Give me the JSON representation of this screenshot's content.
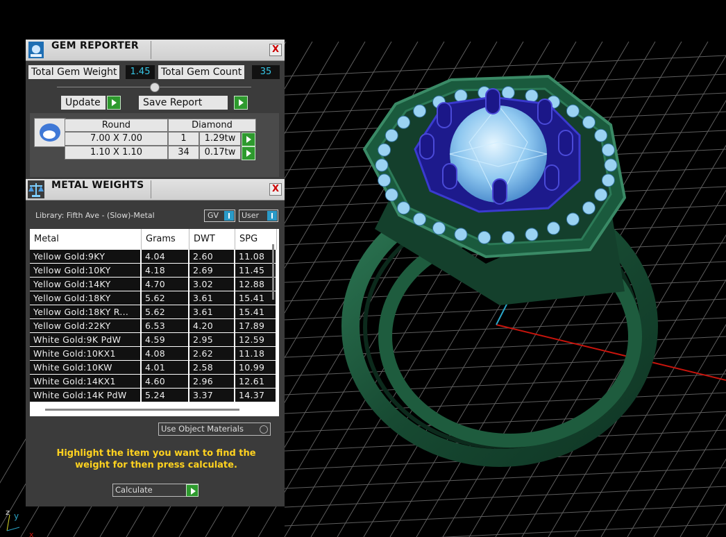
{
  "gem_reporter": {
    "title": "GEM REPORTER",
    "close_label": "X",
    "total_weight_label": "Total Gem Weight",
    "total_weight_value": "1.45",
    "total_count_label": "Total Gem Count",
    "total_count_value": "35",
    "update_label": "Update",
    "save_label": "Save Report",
    "header_shape": "Round",
    "header_type": "Diamond",
    "gems": [
      {
        "size": "7.00 X 7.00",
        "count": "1",
        "weight": "1.29tw"
      },
      {
        "size": "1.10 X 1.10",
        "count": "34",
        "weight": "0.17tw"
      }
    ]
  },
  "metal_weights": {
    "title": "METAL WEIGHTS",
    "close_label": "X",
    "library": "Library: Fifth Ave - (Slow)-Metal",
    "gv_label": "GV",
    "user_label": "User",
    "columns": [
      "Metal",
      "Grams",
      "DWT",
      "SPG"
    ],
    "rows": [
      [
        "Yellow Gold:9KY",
        "4.04",
        "2.60",
        "11.08"
      ],
      [
        "Yellow Gold:10KY",
        "4.18",
        "2.69",
        "11.45"
      ],
      [
        "Yellow Gold:14KY",
        "4.70",
        "3.02",
        "12.88"
      ],
      [
        "Yellow Gold:18KY",
        "5.62",
        "3.61",
        "15.41"
      ],
      [
        "Yellow Gold:18KY R...",
        "5.62",
        "3.61",
        "15.41"
      ],
      [
        "Yellow Gold:22KY",
        "6.53",
        "4.20",
        "17.89"
      ],
      [
        "White Gold:9K PdW",
        "4.59",
        "2.95",
        "12.59"
      ],
      [
        "White Gold:10KX1",
        "4.08",
        "2.62",
        "11.18"
      ],
      [
        "White Gold:10KW",
        "4.01",
        "2.58",
        "10.99"
      ],
      [
        "White Gold:14KX1",
        "4.60",
        "2.96",
        "12.61"
      ],
      [
        "White Gold:14K PdW",
        "5.24",
        "3.37",
        "14.37"
      ]
    ],
    "use_object_label": "Use Object Materials",
    "hint": "Highlight the item you want to find the weight for then press calculate.",
    "calculate_label": "Calculate"
  },
  "axis": {
    "z": "z",
    "y": "y",
    "x": "x"
  },
  "colors": {
    "accent_cyan": "#36c6e6",
    "hint_yellow": "#ffd21f",
    "ring_green": "#1d5a3c",
    "grid": "#6a6a6a"
  }
}
